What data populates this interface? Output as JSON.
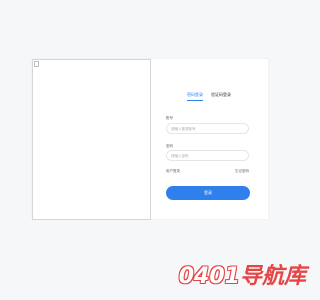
{
  "tabs": [
    {
      "label": "密码登录",
      "active": true
    },
    {
      "label": "验证码登录",
      "active": false
    }
  ],
  "form": {
    "account_label": "账号",
    "account_placeholder": "请输入登录账号",
    "password_label": "密码",
    "password_placeholder": "请输入密码",
    "register_link": "用户登录",
    "forgot_link": "忘记密码",
    "login_button": "登录"
  },
  "watermark": {
    "number": "0401",
    "text": "导航库"
  },
  "colors": {
    "accent": "#2f80ed",
    "watermark_red": "#e64545"
  }
}
